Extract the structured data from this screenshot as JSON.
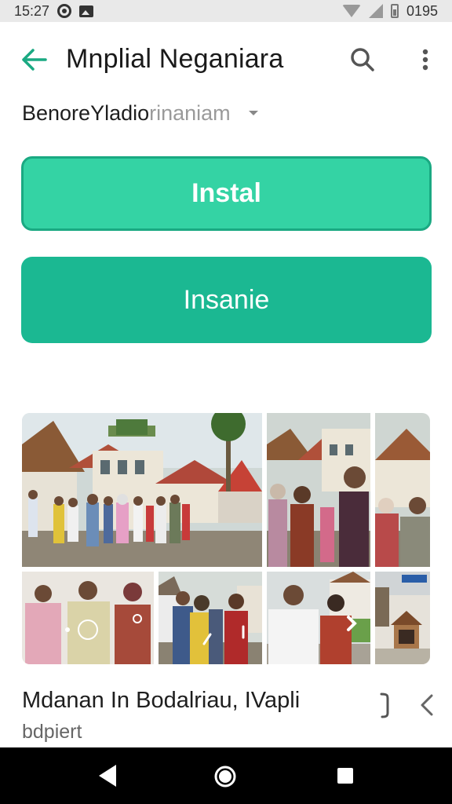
{
  "status_bar": {
    "time": "15:27",
    "battery_text": "0195",
    "icons": [
      "settings-circle-icon",
      "image-notification-icon",
      "wifi-icon",
      "cell-signal-icon",
      "battery-icon"
    ]
  },
  "toolbar": {
    "title": "Mnplial Neganiara",
    "back_icon": "arrow-back-icon",
    "search_icon": "search-icon",
    "more_icon": "more-vert-icon"
  },
  "subtitle": {
    "dark_text": "BenoreYladio",
    "light_text": "rinaniam",
    "caret_icon": "caret-down-icon"
  },
  "buttons": {
    "primary_label": "Instal",
    "secondary_label": "Insanie"
  },
  "gallery": {
    "tiles": [
      {
        "name": "village-street-group-photo"
      },
      {
        "name": "villagers-portrait-photo"
      },
      {
        "name": "woman-and-man-photo"
      },
      {
        "name": "three-people-photo"
      },
      {
        "name": "group-yellow-shirt-photo"
      },
      {
        "name": "man-white-shirt-photo"
      },
      {
        "name": "house-sign-photo"
      }
    ]
  },
  "caption": {
    "title": "Mdanan In Bodalriau, IVapli",
    "subtitle": "bdpiert",
    "share_icon": "share-icon",
    "prev_icon": "chevron-left-icon"
  },
  "colors": {
    "accent": "#1bb892",
    "primary_button": "#34d3a4",
    "back_arrow": "#1aa982",
    "nav_bar": "#000000"
  },
  "nav_bar": {
    "icons": [
      "nav-back-icon",
      "nav-home-icon",
      "nav-recents-icon"
    ]
  }
}
